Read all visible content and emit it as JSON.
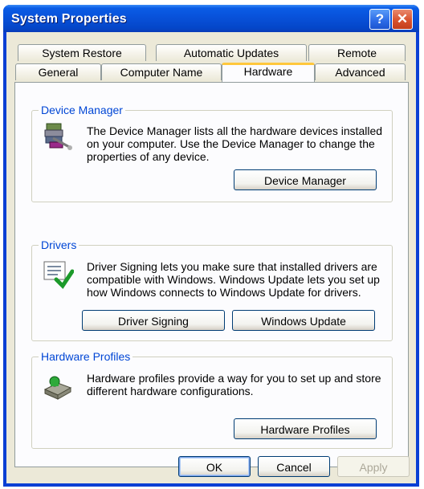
{
  "window": {
    "title": "System Properties"
  },
  "titlebar": {
    "help_glyph": "?",
    "close_glyph": "✕"
  },
  "tabs": {
    "row1": [
      "System Restore",
      "Automatic Updates",
      "Remote"
    ],
    "row2": [
      "General",
      "Computer Name",
      "Hardware",
      "Advanced"
    ],
    "active": "Hardware"
  },
  "device_manager": {
    "legend": "Device Manager",
    "lines": [
      "The Device Manager lists all the hardware devices installed",
      "on your computer. Use the Device Manager to change the",
      "properties of any device."
    ],
    "button": "Device Manager",
    "icon": "device-manager-icon"
  },
  "drivers": {
    "legend": "Drivers",
    "lines": [
      "Driver Signing lets you make sure that installed drivers are",
      "compatible with Windows. Windows Update lets you set up",
      "how Windows connects to Windows Update for drivers."
    ],
    "button_signing": "Driver Signing",
    "button_update": "Windows Update",
    "icon": "driver-signing-icon"
  },
  "hardware_profiles": {
    "legend": "Hardware Profiles",
    "lines": [
      "Hardware profiles provide a way for you to set up and store",
      "different hardware configurations."
    ],
    "button": "Hardware Profiles",
    "icon": "hardware-profiles-icon"
  },
  "footer": {
    "ok": "OK",
    "cancel": "Cancel",
    "apply": "Apply"
  },
  "colors": {
    "title_blue": "#0a5ce6",
    "legend_blue": "#0046d5",
    "tab_highlight": "#ffc73c",
    "close_red": "#d9522e"
  }
}
